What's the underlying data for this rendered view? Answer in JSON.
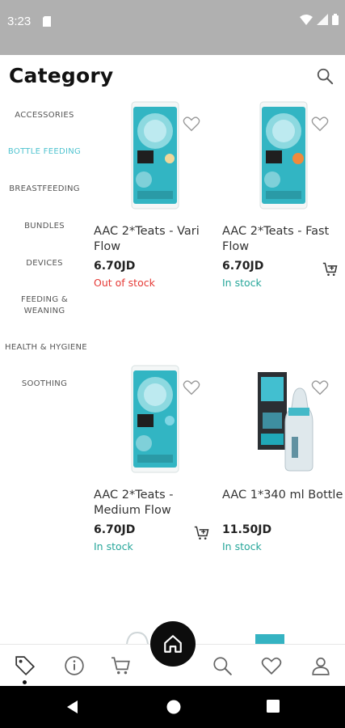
{
  "status_bar": {
    "time": "3:23"
  },
  "header": {
    "title": "Category"
  },
  "sidebar": {
    "items": [
      {
        "label": "ACCESSORIES"
      },
      {
        "label": "BOTTLE FEEDING"
      },
      {
        "label": "BREASTFEEDING"
      },
      {
        "label": "BUNDLES"
      },
      {
        "label": "DEVICES"
      },
      {
        "label": "FEEDING &\nWEANING"
      },
      {
        "label": "HEALTH & HYGIENE"
      },
      {
        "label": "SOOTHING"
      }
    ],
    "active": "BOTTLE FEEDING"
  },
  "products": [
    {
      "name": "AAC 2*Teats - Vari Flow",
      "price": "6.70JD",
      "stock": "Out of stock"
    },
    {
      "name": "AAC 2*Teats - Fast Flow",
      "price": "6.70JD",
      "stock": "In stock"
    },
    {
      "name": "AAC 2*Teats - Medium Flow",
      "price": "6.70JD",
      "stock": "In stock"
    },
    {
      "name": "AAC 1*340 ml Bottle",
      "price": "11.50JD",
      "stock": "In stock"
    }
  ],
  "colors": {
    "accent": "#4fc3cf",
    "out_of_stock": "#e53935",
    "in_stock": "#26a69a"
  },
  "bottom_nav": [
    "tag-icon",
    "info-icon",
    "cart-icon",
    "home-icon",
    "search-icon",
    "heart-icon",
    "user-icon"
  ]
}
